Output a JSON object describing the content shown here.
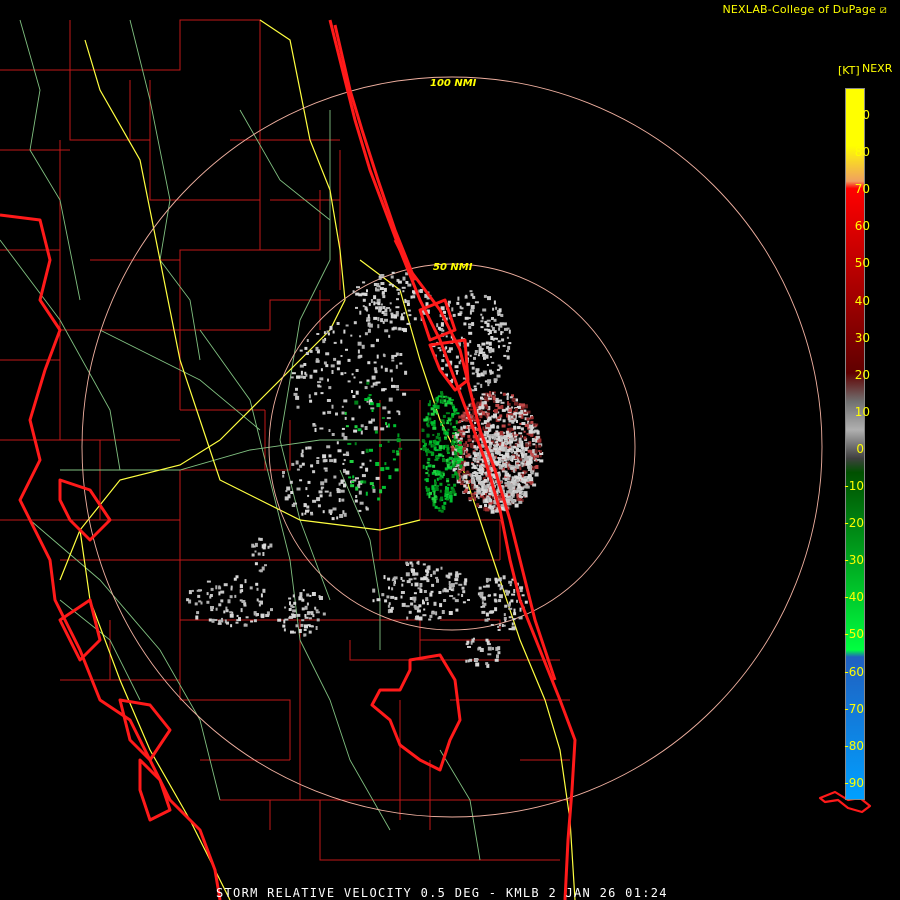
{
  "header": {
    "credit": "NEXLAB-College of DuPage",
    "product": "NEXR",
    "units": "[KT]"
  },
  "footer": {
    "caption": "STORM RELATIVE VELOCITY 0.5 DEG - KMLB 2 JAN 26 01:24"
  },
  "range_rings": [
    {
      "label": "100 NMI"
    },
    {
      "label": "50 NMI"
    }
  ],
  "legend": {
    "ticks": [
      "90",
      "80",
      "70",
      "60",
      "50",
      "40",
      "30",
      "20",
      "10",
      "0",
      "-10",
      "-20",
      "-30",
      "-40",
      "-50",
      "-60",
      "-70",
      "-80",
      "-90"
    ],
    "colors": {
      "top": "#ffff00",
      "orange": "#f0a060",
      "red": "#ff0000",
      "dark_red": "#600000",
      "gray": "#b0b0b0",
      "dark_green": "#005000",
      "green": "#00ff40",
      "blue": "#2060c0",
      "light_blue": "#00a0ff"
    }
  },
  "colors": {
    "county_lines": "#c01818",
    "coast": "#ff1a1a",
    "highways": "#ffff40",
    "roads": "#80c080",
    "rings": "#f0b0a0"
  }
}
